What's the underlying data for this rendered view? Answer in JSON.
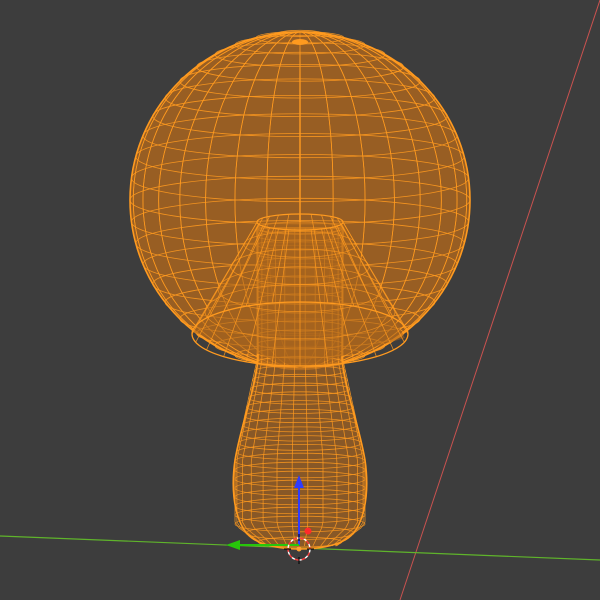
{
  "viewport": {
    "background": "#3d3d3d",
    "shading_mode": "wireframe",
    "selected": true
  },
  "model": {
    "wire_color": "#ff9a1f",
    "fill_color": "#a8641e",
    "parts": [
      "mushroom-cap",
      "cap-underside-cone",
      "stem"
    ]
  },
  "axes": {
    "x_axis_color": "#c9524f",
    "y_axis_color": "#5fb42b"
  },
  "gizmo": {
    "z_color": "#2f3cff",
    "y_color": "#27c60a",
    "x_color": "#ff2a2a",
    "icon": "3d-cursor-icon"
  }
}
